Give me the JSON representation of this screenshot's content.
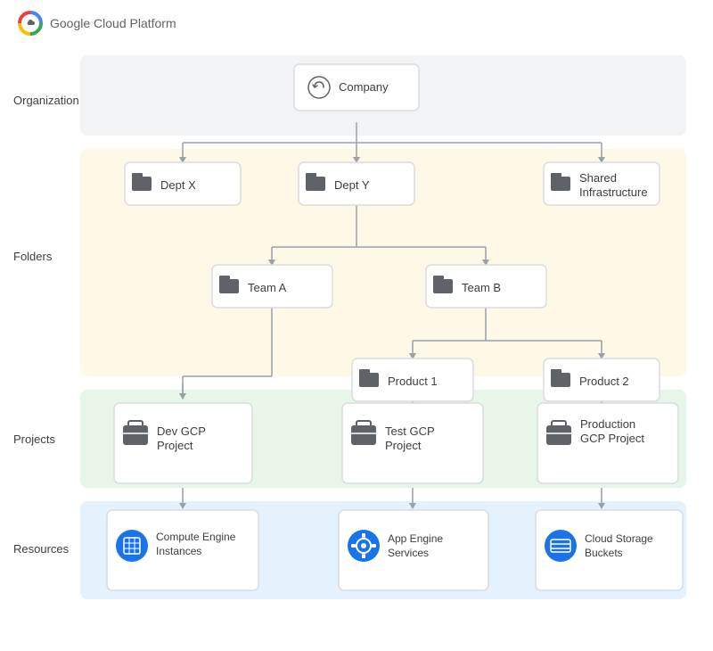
{
  "header": {
    "logo_text": "Google Cloud Platform"
  },
  "sections": {
    "org": {
      "label": "Organization"
    },
    "folders": {
      "label": "Folders"
    },
    "projects": {
      "label": "Projects"
    },
    "resources": {
      "label": "Resources"
    }
  },
  "nodes": {
    "company": {
      "label": "Company"
    },
    "dept_x": {
      "label": "Dept X"
    },
    "dept_y": {
      "label": "Dept Y"
    },
    "shared_infra": {
      "label": "Shared\nInfrastructure"
    },
    "team_a": {
      "label": "Team A"
    },
    "team_b": {
      "label": "Team B"
    },
    "product1": {
      "label": "Product 1"
    },
    "product2": {
      "label": "Product 2"
    },
    "dev_project": {
      "label": "Dev GCP\nProject"
    },
    "test_project": {
      "label": "Test GCP\nProject"
    },
    "prod_project": {
      "label": "Production\nGCP Project"
    },
    "compute": {
      "label": "Compute Engine\nInstances"
    },
    "app_engine": {
      "label": "App Engine\nServices"
    },
    "cloud_storage": {
      "label": "Cloud Storage\nBuckets"
    }
  },
  "colors": {
    "org_bg": "#f1f3f4",
    "folders_bg": "#fef9e7",
    "projects_bg": "#e8f5e9",
    "resources_bg": "#e3f2fd",
    "node_border": "#dadce0",
    "line_color": "#9aa0a6",
    "accent_blue": "#1a73e8"
  }
}
